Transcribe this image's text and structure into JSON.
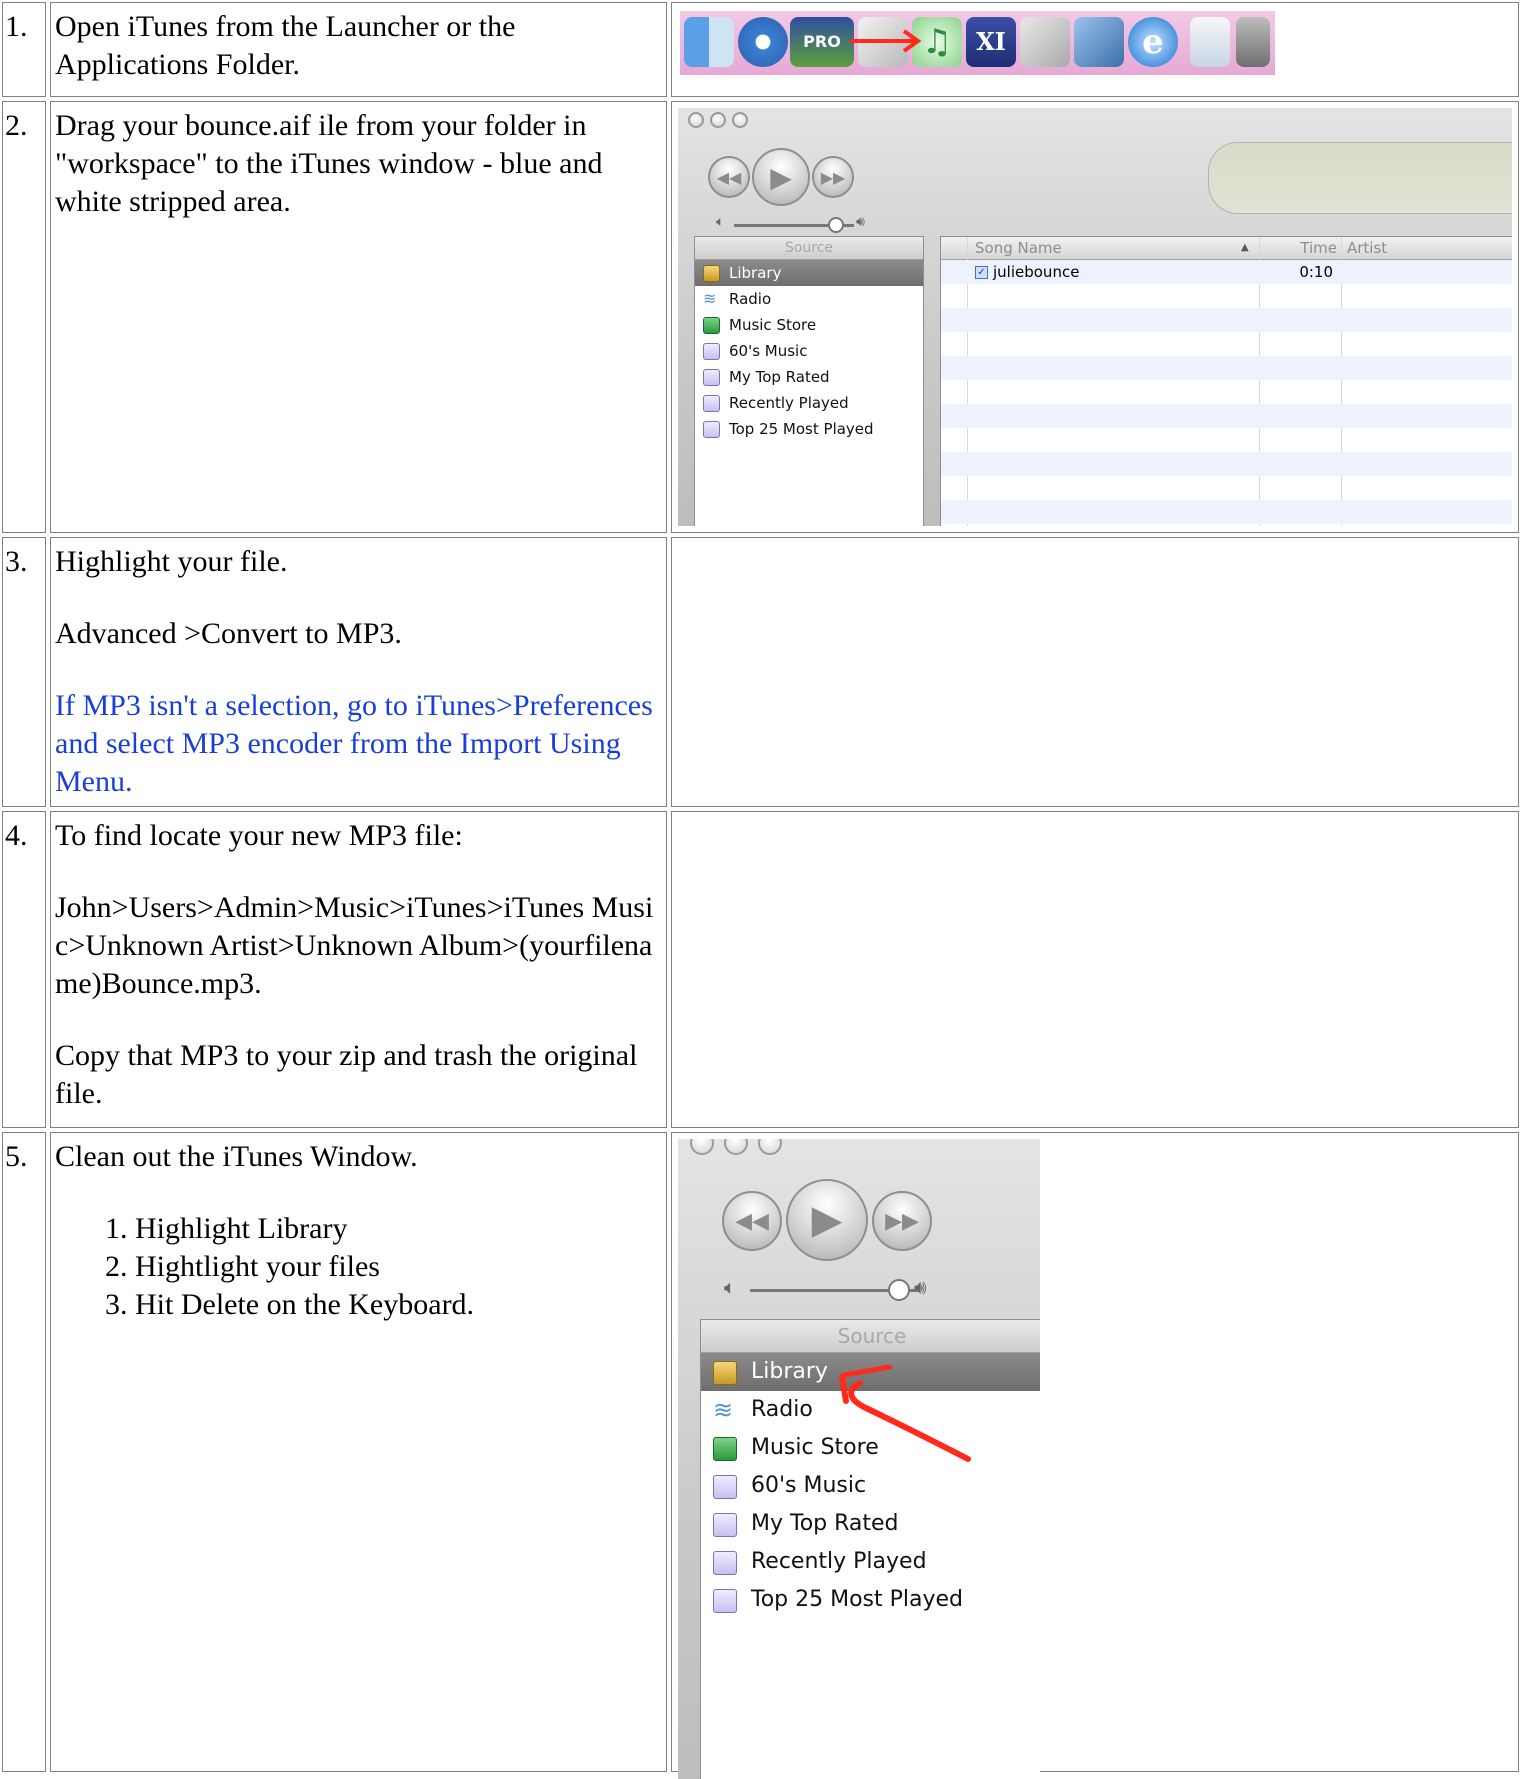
{
  "steps": [
    {
      "number": "1.",
      "text": "Open iTunes from the Launcher or the Applications Folder."
    },
    {
      "number": "2.",
      "text": "Drag your bounce.aif ile from your folder in \"workspace\" to the iTunes window - blue and white stripped area."
    },
    {
      "number": "3.",
      "p1": "Highlight your file.",
      "p2": "Advanced >Convert to MP3.",
      "note": "If MP3 isn't a selection, go to iTunes>Preferences and select MP3 encoder from the Import Using Menu."
    },
    {
      "number": "4.",
      "p1": "To find locate your new MP3 file:",
      "p2": "John>Users>Admin>Music>iTunes>iTunes Music>Unknown Artist>Unknown Album>(yourfilename)Bounce.mp3.",
      "p3": "Copy that MP3 to your zip and trash the original file."
    },
    {
      "number": "5.",
      "p1": "Clean out the iTunes Window.",
      "list": [
        "Highlight Library",
        "Hightlight your files",
        "Hit Delete on the Keyboard."
      ]
    }
  ],
  "dock": {
    "icons": [
      "finder-icon",
      "safari-icon",
      "pro-tools-icon",
      "logic-icon",
      "itunes-icon",
      "xi-icon",
      "system-preferences-icon",
      "iphoto-icon",
      "internet-explorer-icon",
      "document-icon",
      "trash-icon"
    ],
    "pro_tools_label": "PRO"
  },
  "itunes": {
    "source_header": "Source",
    "sources": [
      "Library",
      "Radio",
      "Music Store",
      "60's Music",
      "My Top Rated",
      "Recently Played",
      "Top 25 Most Played"
    ],
    "selected_source": "Library",
    "columns": [
      "Song Name",
      "Time",
      "Artist"
    ],
    "songs": [
      {
        "name": "juliebounce",
        "time": "0:10",
        "checked": true
      }
    ]
  },
  "colors": {
    "note_text": "#1a3fd6",
    "annotation_arrow": "#ff2a1a",
    "dock_background": "#eeb7dd",
    "row_stripe": "#edf3fe"
  }
}
